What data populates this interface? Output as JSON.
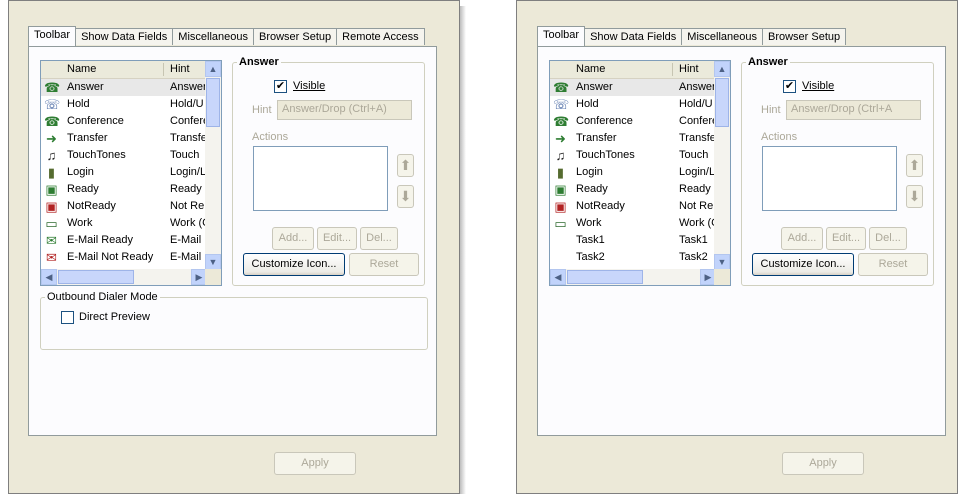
{
  "left": {
    "tabs": [
      "Toolbar",
      "Show Data Fields",
      "Miscellaneous",
      "Browser Setup",
      "Remote Access"
    ],
    "list": {
      "col_name": "Name",
      "col_hint": "Hint",
      "rows": [
        {
          "icon": "answer-icon",
          "glyph": "☎",
          "name": "Answer",
          "hint": "Answer"
        },
        {
          "icon": "hold-icon",
          "glyph": "☏",
          "name": "Hold",
          "hint": "Hold/U"
        },
        {
          "icon": "conference-icon",
          "glyph": "☎",
          "name": "Conference",
          "hint": "Confere"
        },
        {
          "icon": "transfer-icon",
          "glyph": "➜",
          "name": "Transfer",
          "hint": "Transfe"
        },
        {
          "icon": "touchtones-icon",
          "glyph": "♫",
          "name": "TouchTones",
          "hint": "Touch"
        },
        {
          "icon": "login-icon",
          "glyph": "▮",
          "name": "Login",
          "hint": "Login/L"
        },
        {
          "icon": "ready-icon",
          "glyph": "▣",
          "name": "Ready",
          "hint": "Ready"
        },
        {
          "icon": "notready-icon",
          "glyph": "▣",
          "name": "NotReady",
          "hint": "Not Re"
        },
        {
          "icon": "work-icon",
          "glyph": "▭",
          "name": "Work",
          "hint": "Work (C"
        },
        {
          "icon": "email-ready-icon",
          "glyph": "✉",
          "name": "E-Mail Ready",
          "hint": "E-Mail F"
        },
        {
          "icon": "email-notready-icon",
          "glyph": "✉",
          "name": "E-Mail Not Ready",
          "hint": "E-Mail N"
        }
      ]
    },
    "answer_group": {
      "title": "Answer",
      "visible_label": "Visible",
      "visible_checked": "✔",
      "hint_label": "Hint",
      "hint_value": "Answer/Drop (Ctrl+A)",
      "actions_label": "Actions",
      "add": "Add...",
      "edit": "Edit...",
      "del": "Del...",
      "customize": "Customize Icon...",
      "reset": "Reset"
    },
    "outbound": {
      "title": "Outbound Dialer Mode",
      "direct_preview": "Direct Preview"
    },
    "apply": "Apply"
  },
  "right": {
    "tabs": [
      "Toolbar",
      "Show Data Fields",
      "Miscellaneous",
      "Browser Setup"
    ],
    "list": {
      "col_name": "Name",
      "col_hint": "Hint",
      "rows": [
        {
          "icon": "answer-icon",
          "glyph": "☎",
          "name": "Answer",
          "hint": "Answer"
        },
        {
          "icon": "hold-icon",
          "glyph": "☏",
          "name": "Hold",
          "hint": "Hold/U"
        },
        {
          "icon": "conference-icon",
          "glyph": "☎",
          "name": "Conference",
          "hint": "Confere"
        },
        {
          "icon": "transfer-icon",
          "glyph": "➜",
          "name": "Transfer",
          "hint": "Transfe"
        },
        {
          "icon": "touchtones-icon",
          "glyph": "♫",
          "name": "TouchTones",
          "hint": "Touch"
        },
        {
          "icon": "login-icon",
          "glyph": "▮",
          "name": "Login",
          "hint": "Login/L"
        },
        {
          "icon": "ready-icon",
          "glyph": "▣",
          "name": "Ready",
          "hint": "Ready"
        },
        {
          "icon": "notready-icon",
          "glyph": "▣",
          "name": "NotReady",
          "hint": "Not Re"
        },
        {
          "icon": "work-icon",
          "glyph": "▭",
          "name": "Work",
          "hint": "Work (C"
        },
        {
          "icon": "",
          "glyph": "",
          "name": "Task1",
          "hint": "Task1"
        },
        {
          "icon": "",
          "glyph": "",
          "name": "Task2",
          "hint": "Task2"
        }
      ]
    },
    "answer_group": {
      "title": "Answer",
      "visible_label": "Visible",
      "visible_checked": "✔",
      "hint_label": "Hint",
      "hint_value": "Answer/Drop (Ctrl+A",
      "actions_label": "Actions",
      "add": "Add...",
      "edit": "Edit...",
      "del": "Del...",
      "customize": "Customize Icon...",
      "reset": "Reset"
    },
    "apply": "Apply"
  }
}
